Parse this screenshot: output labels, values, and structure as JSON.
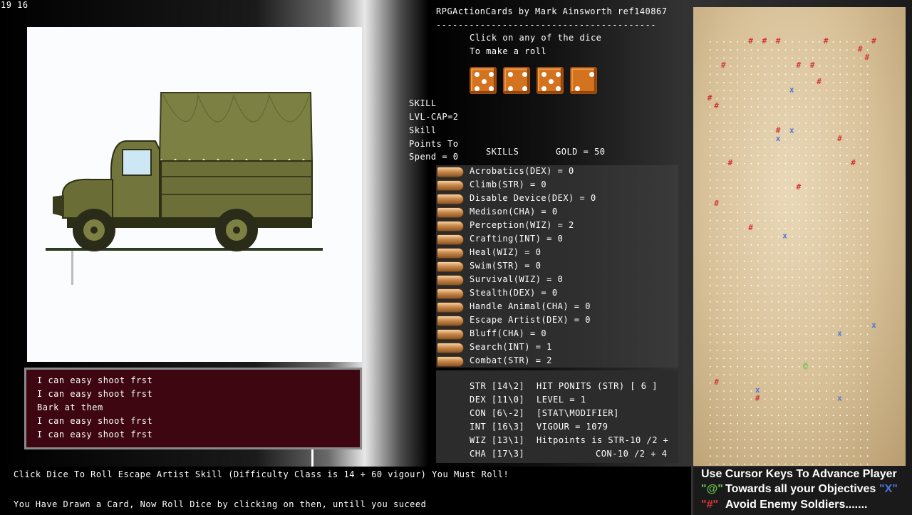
{
  "hud": {
    "fps": "19 16"
  },
  "header": {
    "title": "RPGActionCards by Mark Ainsworth ref140867",
    "rule": "----------------------------------------",
    "instruction_line1": "Click on any of the dice",
    "instruction_line2": "To make a roll"
  },
  "dice": [
    {
      "name": "die-1",
      "face": 5
    },
    {
      "name": "die-2",
      "face": 4
    },
    {
      "name": "die-3",
      "face": 5
    },
    {
      "name": "die-4",
      "face": 2
    }
  ],
  "sidebar": {
    "skill_title": "SKILL",
    "level_cap": "LVL-CAP=2",
    "skill_points_1": "Skill",
    "skill_points_2": "Points To",
    "skill_points_3": "Spend = 0"
  },
  "skills_header": "SKILLS",
  "gold": "GOLD = 50",
  "skills": [
    "Acrobatics(DEX) = 0",
    "Climb(STR) = 0",
    "Disable Device(DEX) = 0",
    "Medison(CHA) = 0",
    "Perception(WIZ) = 2",
    "Crafting(INT) = 0",
    "Heal(WIZ) = 0",
    "Swim(STR) = 0",
    "Survival(WIZ) = 0",
    "Stealth(DEX) = 0",
    "Handle Animal(CHA) = 0",
    "Escape Artist(DEX) = 0",
    "Bluff(CHA) = 0",
    "Search(INT) = 1",
    "Combat(STR) = 2"
  ],
  "stats": {
    "str": "STR [14\\2]",
    "dex": "DEX [11\\0]",
    "con": "CON [6\\-2]",
    "int": "INT [16\\3]",
    "wiz": "WIZ [13\\1]",
    "cha": "CHA [17\\3]",
    "hit_points": "HIT PONITS (STR) [ 6 ]",
    "level": "LEVEL = 1",
    "stat_modifier": "[STAT\\MODIFIER]",
    "vigour": "VIGOUR = 1079",
    "hp_formula_1": "Hitpoints is STR-10 /2 +",
    "hp_formula_2": "CON-10 /2 + 4"
  },
  "log": [
    "I can easy shoot frst",
    "I can easy shoot frst",
    "Bark at them",
    "I can easy shoot frst",
    "I can easy shoot frst"
  ],
  "status": {
    "line1": "Click Dice To Roll Escape Artist Skill (Difficulty Class is 14 + 60 vigour) You Must Roll!",
    "line2": "You Have Drawn a Card, Now Roll Dice by clicking on then, untill you suceed"
  },
  "legend": {
    "line1": "Use Cursor Keys To Advance Player",
    "player_symbol": "\"@\"",
    "line2": "Towards all your Objectives",
    "objective_symbol": "\"X\"",
    "enemy_symbol": "\"#\"",
    "line3": "Avoid Enemy Soldiers.......",
    "player_color": "#67c24a",
    "objective_color": "#4e74d8",
    "enemy_color": "#d23838"
  },
  "map": {
    "grid_cols": 24,
    "grid_rows": 53,
    "enemies": [
      [
        6,
        0
      ],
      [
        8,
        0
      ],
      [
        10,
        0
      ],
      [
        17,
        0
      ],
      [
        24,
        0
      ],
      [
        22,
        1
      ],
      [
        23,
        2
      ],
      [
        2,
        3
      ],
      [
        13,
        3
      ],
      [
        15,
        3
      ],
      [
        16,
        5
      ],
      [
        0,
        7
      ],
      [
        1,
        8
      ],
      [
        10,
        11
      ],
      [
        19,
        12
      ],
      [
        3,
        15
      ],
      [
        21,
        15
      ],
      [
        13,
        18
      ],
      [
        1,
        20
      ],
      [
        6,
        23
      ],
      [
        1,
        42
      ],
      [
        7,
        44
      ]
    ],
    "objectives": [
      [
        12,
        6
      ],
      [
        12,
        11
      ],
      [
        10,
        12
      ],
      [
        11,
        24
      ],
      [
        19,
        36
      ],
      [
        24,
        35
      ],
      [
        7,
        43
      ],
      [
        19,
        44
      ]
    ],
    "player": [
      14,
      40
    ]
  }
}
